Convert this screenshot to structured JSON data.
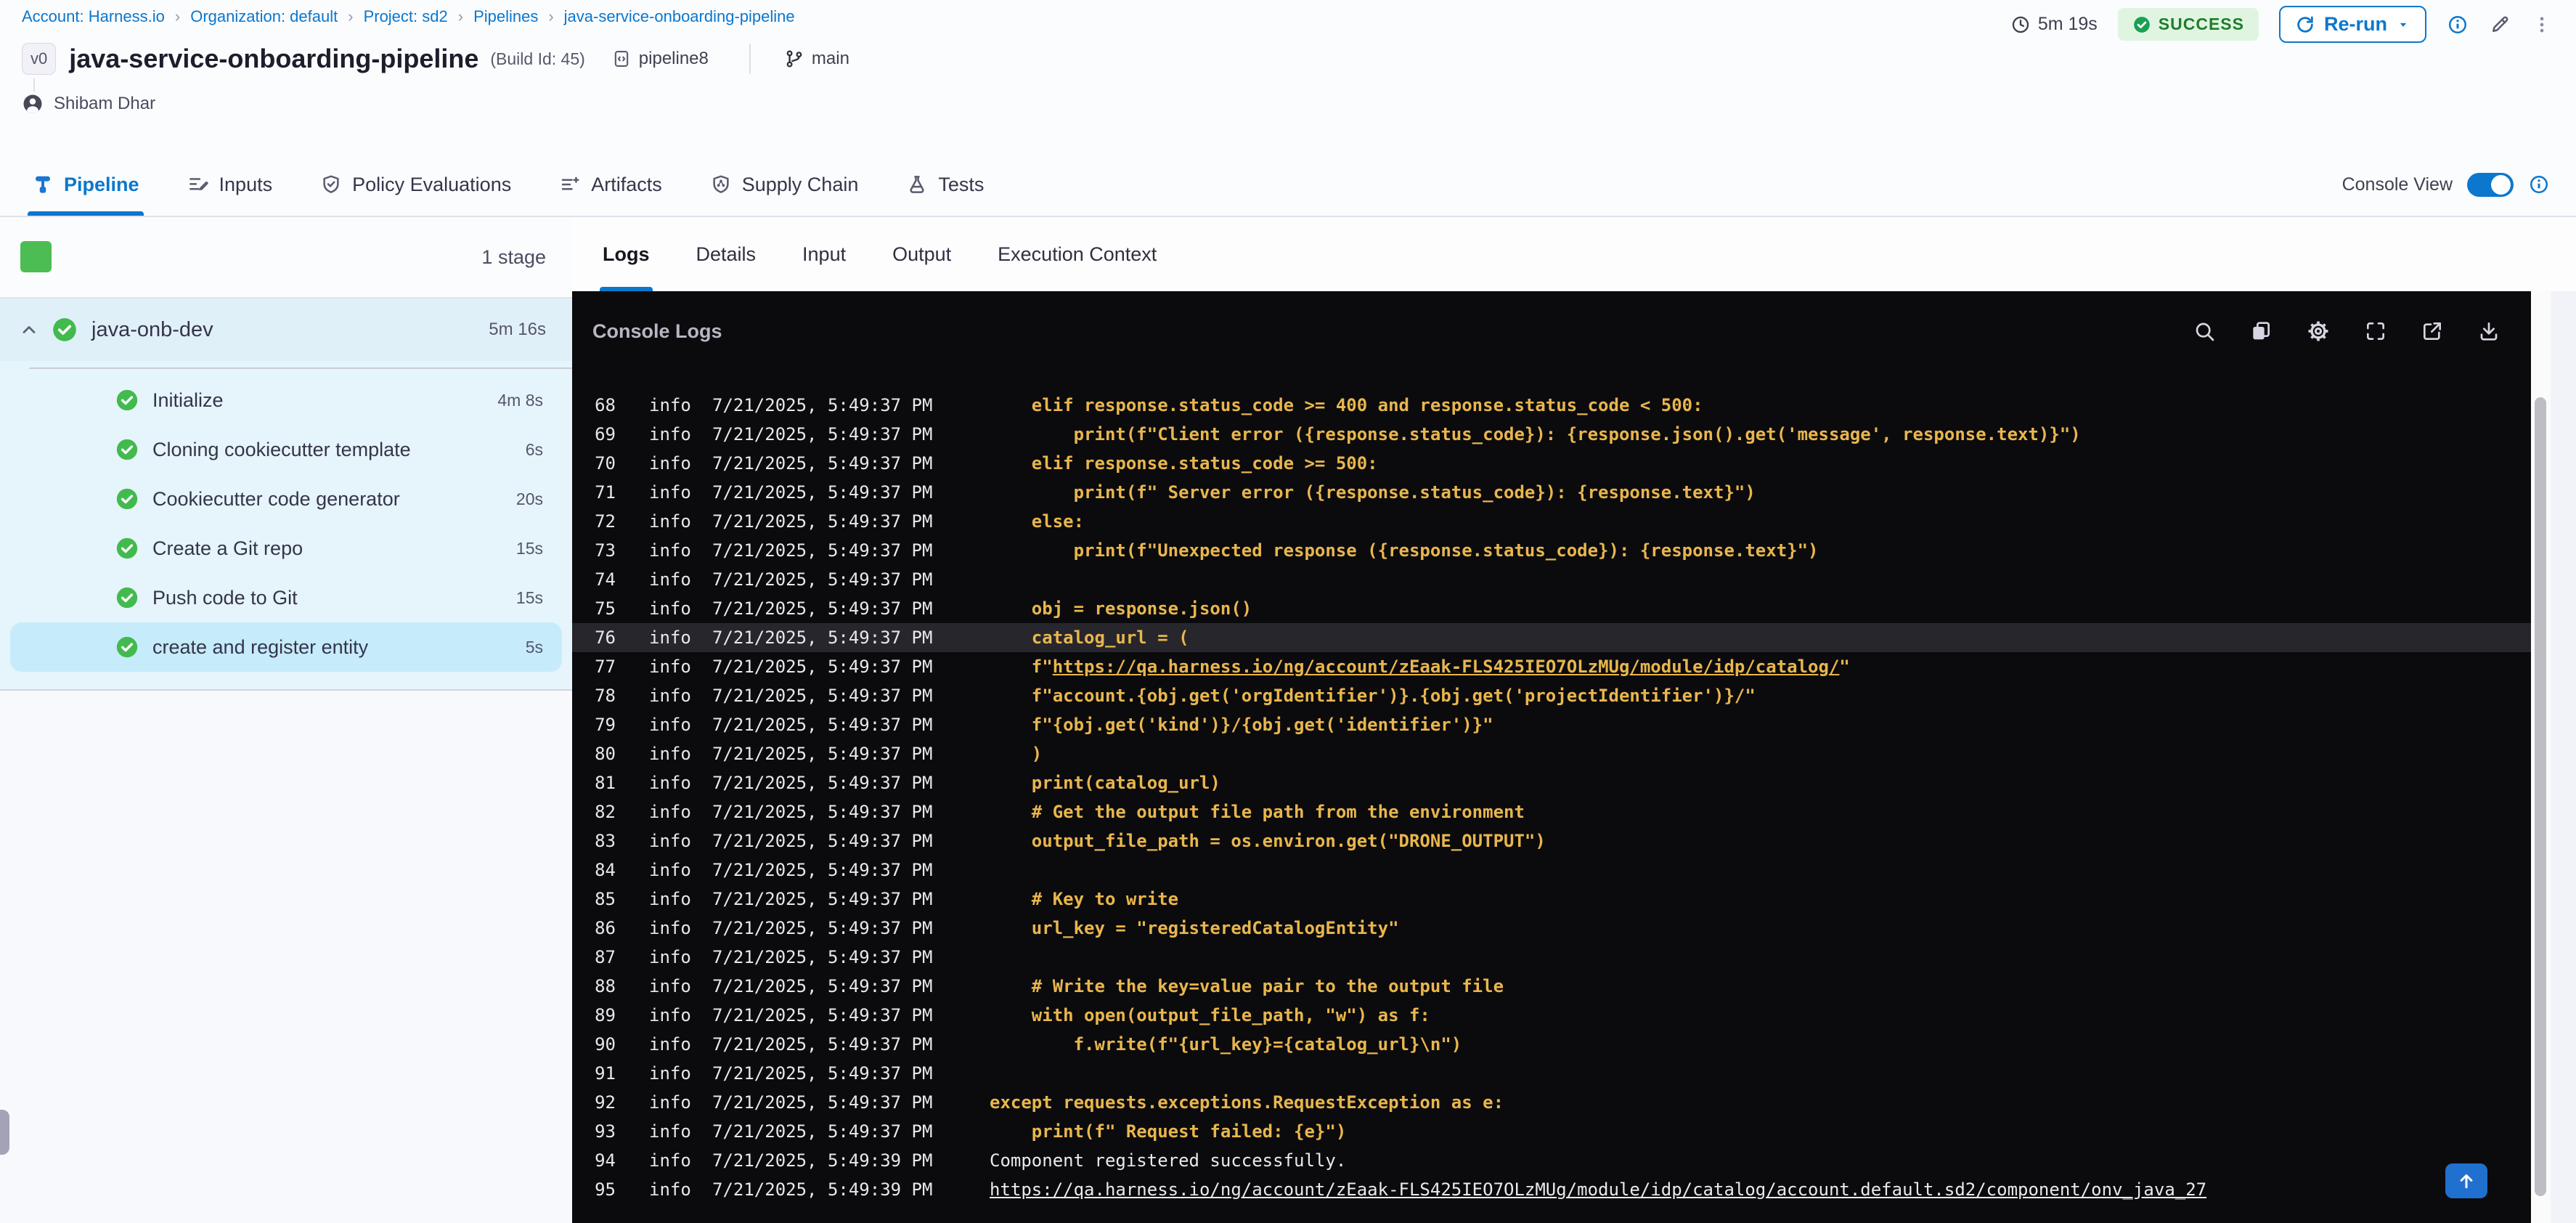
{
  "breadcrumb": {
    "separator": "›",
    "items": [
      "Account: Harness.io",
      "Organization: default",
      "Project: sd2",
      "Pipelines",
      "java-service-onboarding-pipeline"
    ]
  },
  "run_meta": {
    "duration": "5m 19s",
    "status": "SUCCESS",
    "rerun_label": "Re-run"
  },
  "pipeline": {
    "version_badge": "v0",
    "title": "java-service-onboarding-pipeline",
    "build_id": "(Build Id: 45)",
    "repo": "pipeline8",
    "branch": "main",
    "author": "Shibam Dhar"
  },
  "header_tabs": [
    {
      "label": "Pipeline",
      "icon": "pipeline-icon",
      "active": true
    },
    {
      "label": "Inputs",
      "icon": "inputs-icon",
      "active": false
    },
    {
      "label": "Policy Evaluations",
      "icon": "policy-shield-icon",
      "active": false
    },
    {
      "label": "Artifacts",
      "icon": "artifacts-icon",
      "active": false
    },
    {
      "label": "Supply Chain",
      "icon": "supply-chain-icon",
      "active": false
    },
    {
      "label": "Tests",
      "icon": "tests-flask-icon",
      "active": false
    }
  ],
  "console_view": {
    "label": "Console View",
    "enabled": true
  },
  "stage_panel": {
    "count_label": "1 stage",
    "stage": {
      "name": "java-onb-dev",
      "duration": "5m 16s",
      "status": "success"
    },
    "steps": [
      {
        "label": "Initialize",
        "duration": "4m 8s",
        "selected": false
      },
      {
        "label": "Cloning cookiecutter template",
        "duration": "6s",
        "selected": false
      },
      {
        "label": "Cookiecutter code generator",
        "duration": "20s",
        "selected": false
      },
      {
        "label": "Create a Git repo",
        "duration": "15s",
        "selected": false
      },
      {
        "label": "Push code to Git",
        "duration": "15s",
        "selected": false
      },
      {
        "label": "create and register entity",
        "duration": "5s",
        "selected": true
      }
    ]
  },
  "log_panel": {
    "tabs": [
      {
        "label": "Logs",
        "active": true
      },
      {
        "label": "Details",
        "active": false
      },
      {
        "label": "Input",
        "active": false
      },
      {
        "label": "Output",
        "active": false
      },
      {
        "label": "Execution Context",
        "active": false
      }
    ],
    "title": "Console Logs",
    "toolbar_icons": [
      "search-icon",
      "copy-icon",
      "settings-icon",
      "fullscreen-icon",
      "open-new-tab-icon",
      "download-icon"
    ],
    "lines": [
      {
        "n": "68",
        "lvl": "info",
        "ts": "7/21/2025, 5:49:37 PM",
        "style": "code",
        "hl": false,
        "segs": [
          {
            "t": "    elif response.status_code >= 400 and response.status_code < 500:"
          }
        ]
      },
      {
        "n": "69",
        "lvl": "info",
        "ts": "7/21/2025, 5:49:37 PM",
        "style": "code",
        "hl": false,
        "segs": [
          {
            "t": "        print(f\"Client error ({response.status_code}): {response.json().get('message', response.text)}\")"
          }
        ]
      },
      {
        "n": "70",
        "lvl": "info",
        "ts": "7/21/2025, 5:49:37 PM",
        "style": "code",
        "hl": false,
        "segs": [
          {
            "t": "    elif response.status_code >= 500:"
          }
        ]
      },
      {
        "n": "71",
        "lvl": "info",
        "ts": "7/21/2025, 5:49:37 PM",
        "style": "code",
        "hl": false,
        "segs": [
          {
            "t": "        print(f\" Server error ({response.status_code}): {response.text}\")"
          }
        ]
      },
      {
        "n": "72",
        "lvl": "info",
        "ts": "7/21/2025, 5:49:37 PM",
        "style": "code",
        "hl": false,
        "segs": [
          {
            "t": "    else:"
          }
        ]
      },
      {
        "n": "73",
        "lvl": "info",
        "ts": "7/21/2025, 5:49:37 PM",
        "style": "code",
        "hl": false,
        "segs": [
          {
            "t": "        print(f\"Unexpected response ({response.status_code}): {response.text}\")"
          }
        ]
      },
      {
        "n": "74",
        "lvl": "info",
        "ts": "7/21/2025, 5:49:37 PM",
        "style": "code",
        "hl": false,
        "segs": [
          {
            "t": ""
          }
        ]
      },
      {
        "n": "75",
        "lvl": "info",
        "ts": "7/21/2025, 5:49:37 PM",
        "style": "code",
        "hl": false,
        "segs": [
          {
            "t": "    obj = response.json()"
          }
        ]
      },
      {
        "n": "76",
        "lvl": "info",
        "ts": "7/21/2025, 5:49:37 PM",
        "style": "code",
        "hl": true,
        "segs": [
          {
            "t": "    catalog_url = ("
          }
        ]
      },
      {
        "n": "77",
        "lvl": "info",
        "ts": "7/21/2025, 5:49:37 PM",
        "style": "code",
        "hl": false,
        "segs": [
          {
            "t": "    f\""
          },
          {
            "t": "https://qa.harness.io/ng/account/zEaak-FLS425IEO7OLzMUg/module/idp/catalog/",
            "link": true
          },
          {
            "t": "\""
          }
        ]
      },
      {
        "n": "78",
        "lvl": "info",
        "ts": "7/21/2025, 5:49:37 PM",
        "style": "code",
        "hl": false,
        "segs": [
          {
            "t": "    f\"account.{obj.get('orgIdentifier')}.{obj.get('projectIdentifier')}/\""
          }
        ]
      },
      {
        "n": "79",
        "lvl": "info",
        "ts": "7/21/2025, 5:49:37 PM",
        "style": "code",
        "hl": false,
        "segs": [
          {
            "t": "    f\"{obj.get('kind')}/{obj.get('identifier')}\""
          }
        ]
      },
      {
        "n": "80",
        "lvl": "info",
        "ts": "7/21/2025, 5:49:37 PM",
        "style": "code",
        "hl": false,
        "segs": [
          {
            "t": "    )"
          }
        ]
      },
      {
        "n": "81",
        "lvl": "info",
        "ts": "7/21/2025, 5:49:37 PM",
        "style": "code",
        "hl": false,
        "segs": [
          {
            "t": "    print(catalog_url)"
          }
        ]
      },
      {
        "n": "82",
        "lvl": "info",
        "ts": "7/21/2025, 5:49:37 PM",
        "style": "code",
        "hl": false,
        "segs": [
          {
            "t": "    # Get the output file path from the environment"
          }
        ]
      },
      {
        "n": "83",
        "lvl": "info",
        "ts": "7/21/2025, 5:49:37 PM",
        "style": "code",
        "hl": false,
        "segs": [
          {
            "t": "    output_file_path = os.environ.get(\"DRONE_OUTPUT\")"
          }
        ]
      },
      {
        "n": "84",
        "lvl": "info",
        "ts": "7/21/2025, 5:49:37 PM",
        "style": "code",
        "hl": false,
        "segs": [
          {
            "t": ""
          }
        ]
      },
      {
        "n": "85",
        "lvl": "info",
        "ts": "7/21/2025, 5:49:37 PM",
        "style": "code",
        "hl": false,
        "segs": [
          {
            "t": "    # Key to write"
          }
        ]
      },
      {
        "n": "86",
        "lvl": "info",
        "ts": "7/21/2025, 5:49:37 PM",
        "style": "code",
        "hl": false,
        "segs": [
          {
            "t": "    url_key = \"registeredCatalogEntity\""
          }
        ]
      },
      {
        "n": "87",
        "lvl": "info",
        "ts": "7/21/2025, 5:49:37 PM",
        "style": "code",
        "hl": false,
        "segs": [
          {
            "t": ""
          }
        ]
      },
      {
        "n": "88",
        "lvl": "info",
        "ts": "7/21/2025, 5:49:37 PM",
        "style": "code",
        "hl": false,
        "segs": [
          {
            "t": "    # Write the key=value pair to the output file"
          }
        ]
      },
      {
        "n": "89",
        "lvl": "info",
        "ts": "7/21/2025, 5:49:37 PM",
        "style": "code",
        "hl": false,
        "segs": [
          {
            "t": "    with open(output_file_path, \"w\") as f:"
          }
        ]
      },
      {
        "n": "90",
        "lvl": "info",
        "ts": "7/21/2025, 5:49:37 PM",
        "style": "code",
        "hl": false,
        "segs": [
          {
            "t": "        f.write(f\"{url_key}={catalog_url}\\n\")"
          }
        ]
      },
      {
        "n": "91",
        "lvl": "info",
        "ts": "7/21/2025, 5:49:37 PM",
        "style": "code",
        "hl": false,
        "segs": [
          {
            "t": ""
          }
        ]
      },
      {
        "n": "92",
        "lvl": "info",
        "ts": "7/21/2025, 5:49:37 PM",
        "style": "code",
        "hl": false,
        "segs": [
          {
            "t": "except requests.exceptions.RequestException as e:"
          }
        ]
      },
      {
        "n": "93",
        "lvl": "info",
        "ts": "7/21/2025, 5:49:37 PM",
        "style": "code",
        "hl": false,
        "segs": [
          {
            "t": "    print(f\" Request failed: {e}\")"
          }
        ]
      },
      {
        "n": "94",
        "lvl": "info",
        "ts": "7/21/2025, 5:49:39 PM",
        "style": "plain",
        "hl": false,
        "segs": [
          {
            "t": "Component registered successfully."
          }
        ]
      },
      {
        "n": "95",
        "lvl": "info",
        "ts": "7/21/2025, 5:49:39 PM",
        "style": "plain",
        "hl": false,
        "segs": [
          {
            "t": "https://qa.harness.io/ng/account/zEaak-FLS425IEO7OLzMUg/module/idp/catalog/account.default.sd2/component/onv_java_27",
            "link": true
          }
        ]
      }
    ]
  },
  "colors": {
    "accent_blue": "#0b77cd",
    "success_green": "#1aa053",
    "log_yellow": "#e9b64d",
    "console_bg": "#0b0b0e",
    "selected_step_bg": "#c6ebfa"
  }
}
